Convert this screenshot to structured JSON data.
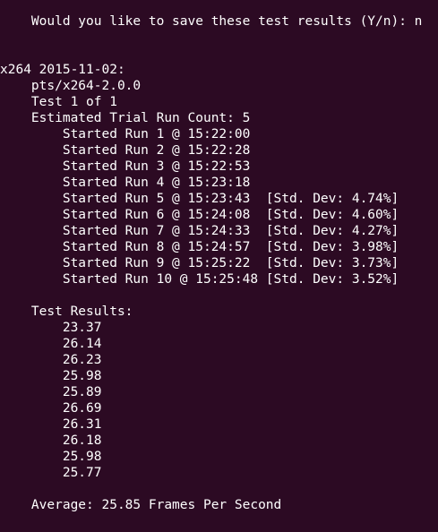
{
  "terminal": {
    "save_prompt": "    Would you like to save these test results (Y/n): n",
    "test_header": "x264 2015-11-02:",
    "profile": "    pts/x264-2.0.0",
    "test_counter": "    Test 1 of 1",
    "estimated_runs": "    Estimated Trial Run Count: 5",
    "runs": [
      "        Started Run 1 @ 15:22:00",
      "        Started Run 2 @ 15:22:28",
      "        Started Run 3 @ 15:22:53",
      "        Started Run 4 @ 15:23:18",
      "        Started Run 5 @ 15:23:43  [Std. Dev: 4.74%]",
      "        Started Run 6 @ 15:24:08  [Std. Dev: 4.60%]",
      "        Started Run 7 @ 15:24:33  [Std. Dev: 4.27%]",
      "        Started Run 8 @ 15:24:57  [Std. Dev: 3.98%]",
      "        Started Run 9 @ 15:25:22  [Std. Dev: 3.73%]",
      "        Started Run 10 @ 15:25:48 [Std. Dev: 3.52%]"
    ],
    "results_label": "    Test Results:",
    "results": [
      "        23.37",
      "        26.14",
      "        26.23",
      "        25.98",
      "        25.89",
      "        26.69",
      "        26.31",
      "        26.18",
      "        25.98",
      "        25.77"
    ],
    "average": "    Average: 25.85 Frames Per Second"
  }
}
